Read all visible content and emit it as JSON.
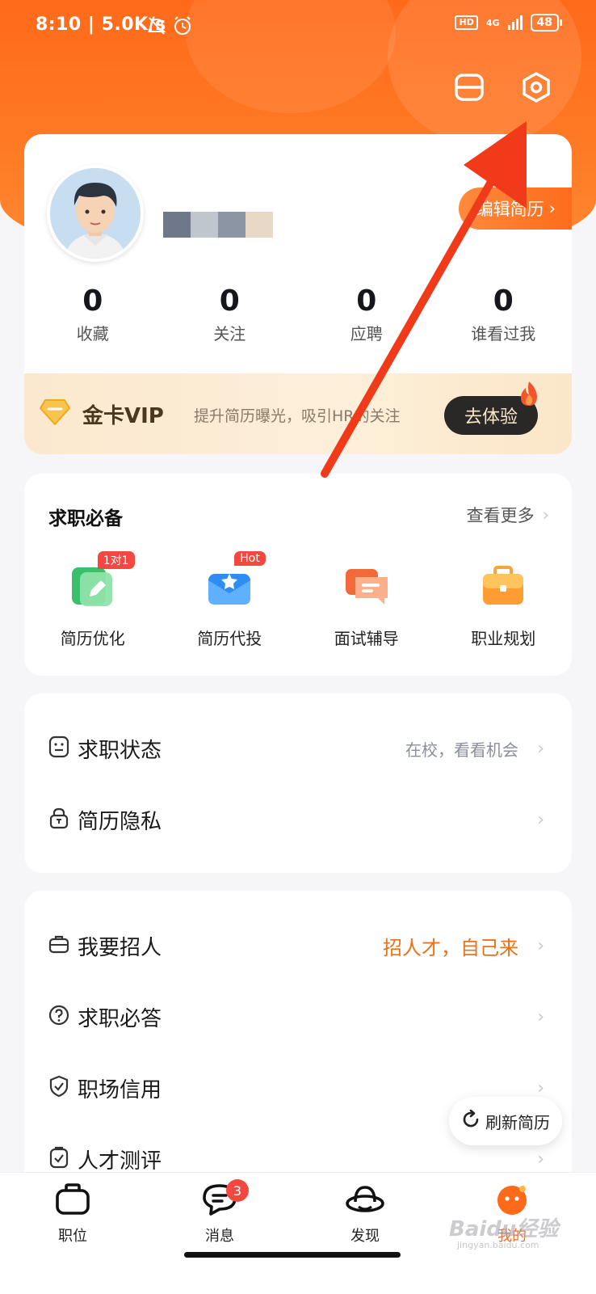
{
  "status_bar": {
    "time": "8:10 | 5.0K/s",
    "hd": "HD",
    "network": "4G",
    "battery": "48"
  },
  "profile": {
    "edit_resume": "编辑简历",
    "stats": [
      {
        "value": "0",
        "label": "收藏"
      },
      {
        "value": "0",
        "label": "关注"
      },
      {
        "value": "0",
        "label": "应聘"
      },
      {
        "value": "0",
        "label": "谁看过我"
      }
    ],
    "vip": {
      "title": "金卡VIP",
      "desc": "提升简历曝光，吸引HR的关注",
      "button": "去体验"
    }
  },
  "job_essentials": {
    "title": "求职必备",
    "more": "查看更多",
    "items": [
      {
        "label": "简历优化",
        "badge": "1对1"
      },
      {
        "label": "简历代投",
        "badge": "Hot"
      },
      {
        "label": "面试辅导"
      },
      {
        "label": "职业规划"
      }
    ]
  },
  "settings_group1": [
    {
      "label": "求职状态",
      "value": "在校，看看机会"
    },
    {
      "label": "简历隐私"
    }
  ],
  "settings_group2": [
    {
      "label": "我要招人",
      "value": "招人才，自己来"
    },
    {
      "label": "求职必答"
    },
    {
      "label": "职场信用"
    },
    {
      "label": "人才测评"
    }
  ],
  "refresh_button": "刷新简历",
  "tabbar": {
    "items": [
      {
        "label": "职位"
      },
      {
        "label": "消息",
        "badge": "3"
      },
      {
        "label": "发现"
      },
      {
        "label": "我的"
      }
    ]
  },
  "watermark": {
    "logo": "Baidu经验",
    "url": "jingyan.baidu.com"
  },
  "colors": {
    "accent": "#ff6a1a",
    "badge": "#f4473f",
    "arrow": "#f03a1a"
  }
}
